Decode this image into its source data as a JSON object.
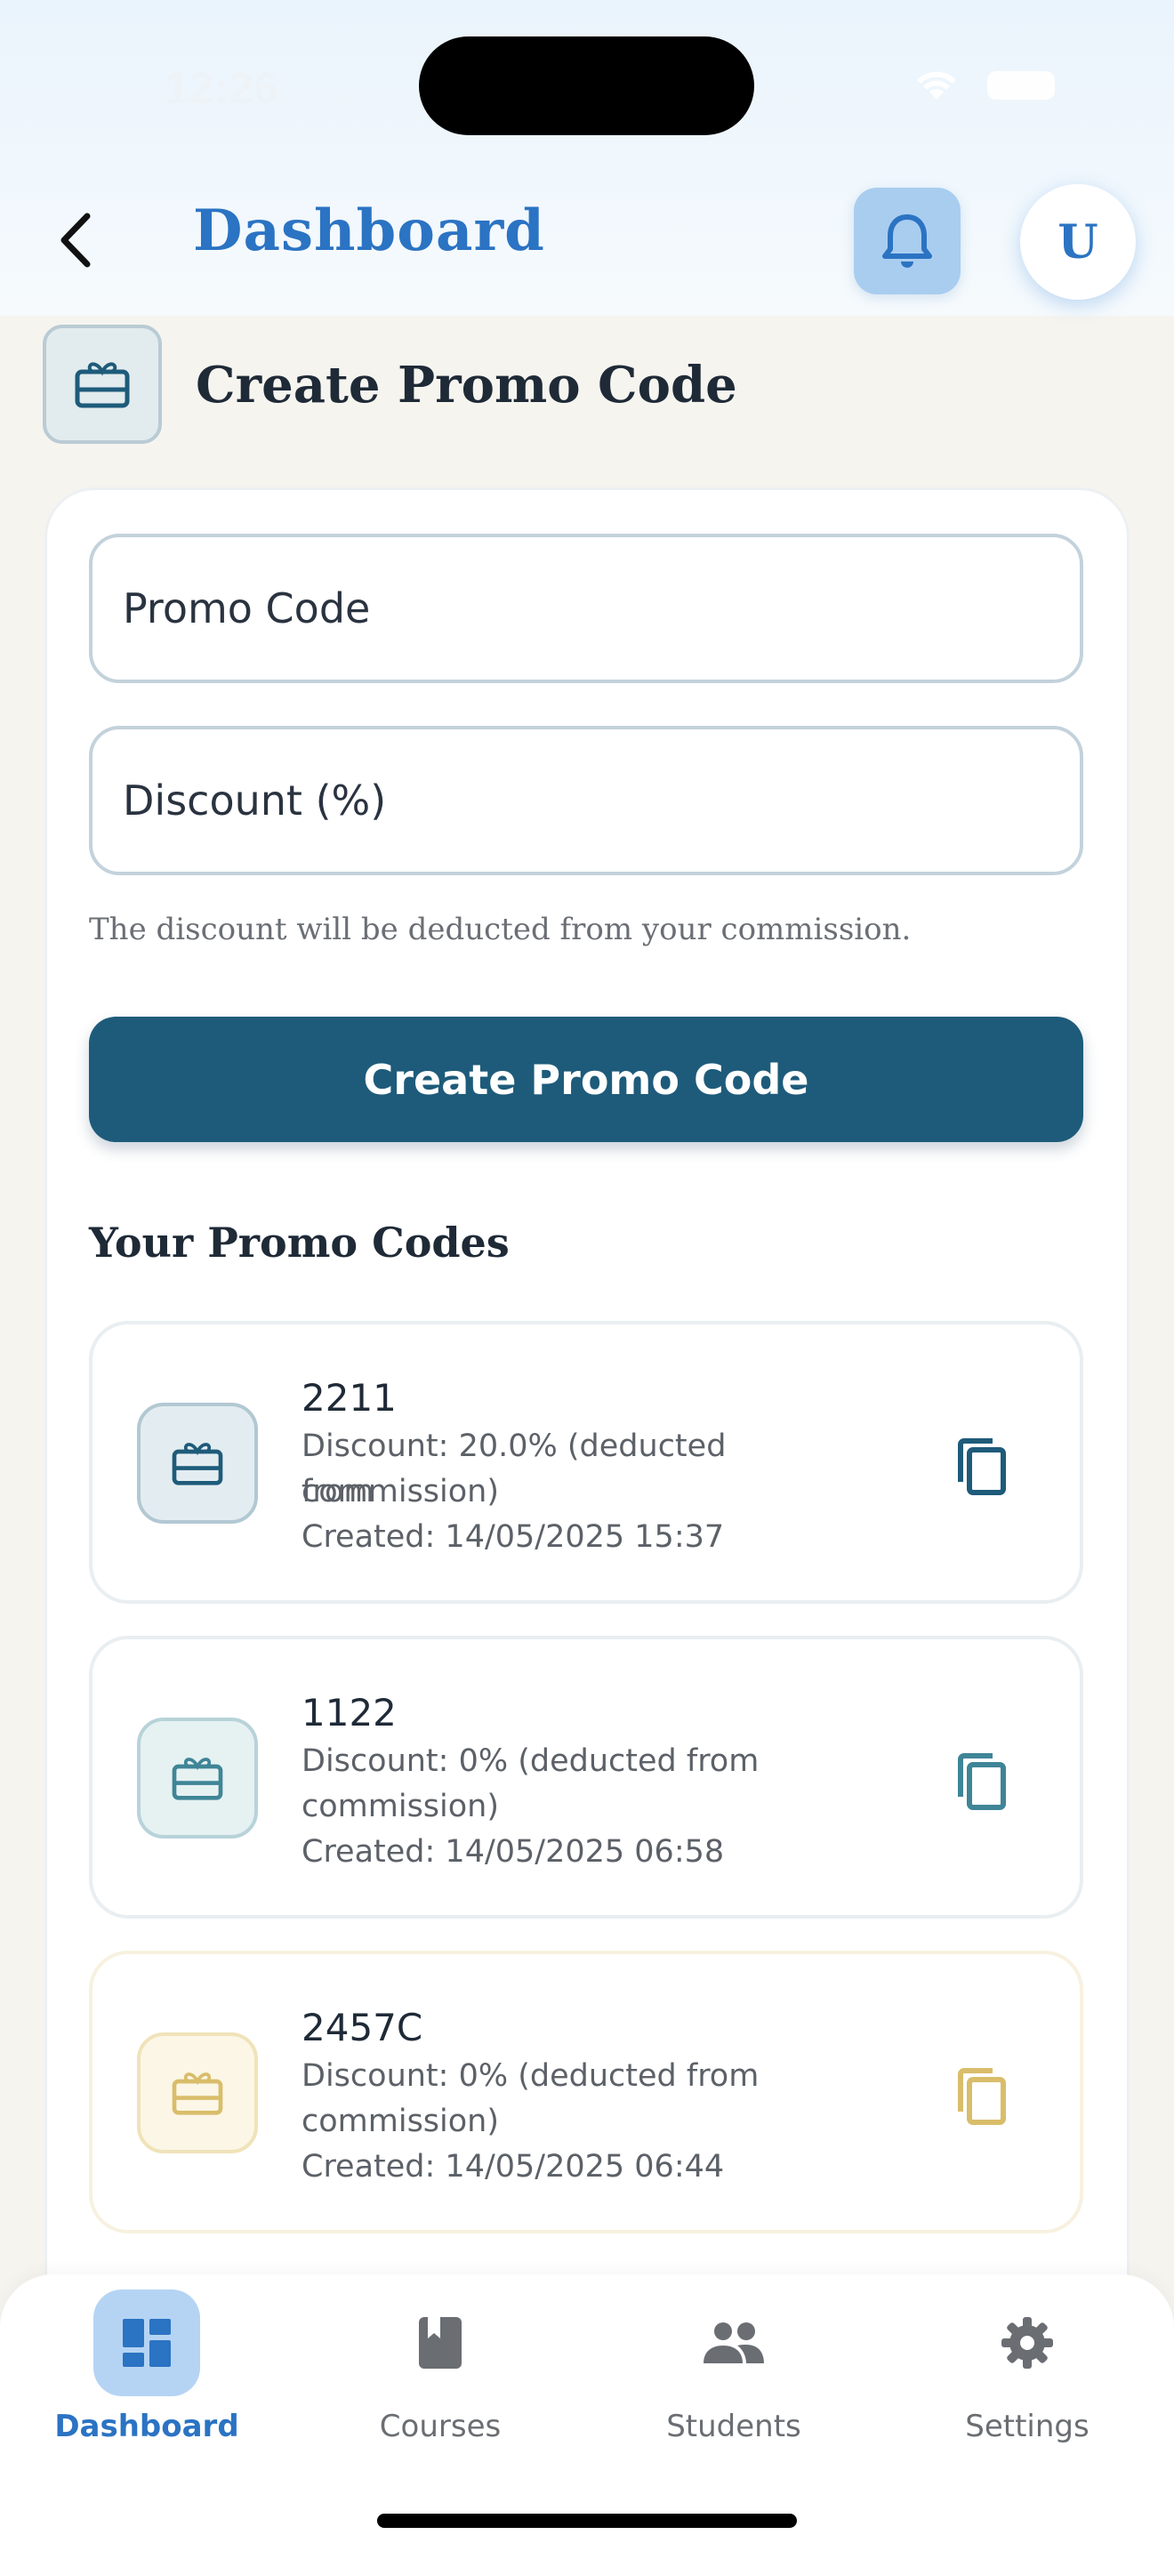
{
  "status_bar": {
    "time": "12:26"
  },
  "header": {
    "title": "Dashboard",
    "avatar_initial": "U"
  },
  "section": {
    "title": "Create Promo Code"
  },
  "form": {
    "promo_code_placeholder": "Promo Code",
    "discount_placeholder": "Discount (%)",
    "helper_text": "The discount will be deducted from your commission.",
    "submit_label": "Create Promo Code"
  },
  "promo_list": {
    "title": "Your Promo Codes",
    "items": [
      {
        "code": "2211",
        "discount": "Discount: 20.0% (deducted from",
        "discount_cont": "commission)",
        "created": "Created: 14/05/2025 15:37",
        "accent": "#1e5b7a"
      },
      {
        "code": "1122",
        "discount": "Discount: 0% (deducted from",
        "discount_cont": "commission)",
        "created": "Created: 14/05/2025 06:58",
        "accent": "#3f8597"
      },
      {
        "code": "2457C",
        "discount": "Discount: 0% (deducted from",
        "discount_cont": "commission)",
        "created": "Created: 14/05/2025 06:44",
        "accent": "#d9bd6a"
      }
    ]
  },
  "bottom_nav": {
    "items": [
      {
        "label": "Dashboard",
        "icon": "dashboard-icon",
        "active": true
      },
      {
        "label": "Courses",
        "icon": "book-icon",
        "active": false
      },
      {
        "label": "Students",
        "icon": "people-icon",
        "active": false
      },
      {
        "label": "Settings",
        "icon": "gear-icon",
        "active": false
      }
    ]
  },
  "colors": {
    "brand_blue": "#2b73c3",
    "button_teal": "#1e5b7a",
    "background": "#f6f4ef"
  }
}
